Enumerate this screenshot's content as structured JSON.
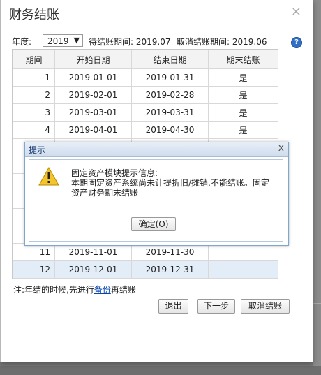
{
  "dialog": {
    "title": "财务结账",
    "close": "×"
  },
  "toolbar": {
    "year_label": "年度:",
    "year_value": "2019",
    "year_arrow": "▼",
    "pending_period": "待结账期间: 2019.07",
    "cancel_period": "取消结账期间: 2019.06",
    "help": "?"
  },
  "table": {
    "headers": [
      "期间",
      "开始日期",
      "结束日期",
      "期末结账"
    ],
    "rows": [
      [
        "1",
        "2019-01-01",
        "2019-01-31",
        "是"
      ],
      [
        "2",
        "2019-02-01",
        "2019-02-28",
        "是"
      ],
      [
        "3",
        "2019-03-01",
        "2019-03-31",
        "是"
      ],
      [
        "4",
        "2019-04-01",
        "2019-04-30",
        "是"
      ],
      [
        "",
        "",
        "",
        ""
      ],
      [
        "",
        "",
        "",
        ""
      ],
      [
        "",
        "",
        "",
        ""
      ],
      [
        "",
        "",
        "",
        ""
      ],
      [
        "",
        "",
        "",
        ""
      ],
      [
        "",
        "",
        "",
        ""
      ],
      [
        "11",
        "2019-11-01",
        "2019-11-30",
        ""
      ],
      [
        "12",
        "2019-12-01",
        "2019-12-31",
        ""
      ]
    ],
    "selected_row": 11
  },
  "note": {
    "prefix": "注:年结的时候,先进行",
    "link": "备份",
    "suffix": "再结账"
  },
  "buttons": {
    "exit": "退出",
    "next": "下一步",
    "cancel_close": "取消结账"
  },
  "message": {
    "title": "提示",
    "close": "x",
    "line1": "固定资产模块提示信息:",
    "line2": "本期固定资产系统尚未计提折旧/摊销,不能结账。固定资产财务期末结账",
    "ok": "确定(O)"
  },
  "colors": {
    "selected_row": "#e3edf7",
    "link": "#0645ad",
    "title_bar": "#cfdcec"
  }
}
